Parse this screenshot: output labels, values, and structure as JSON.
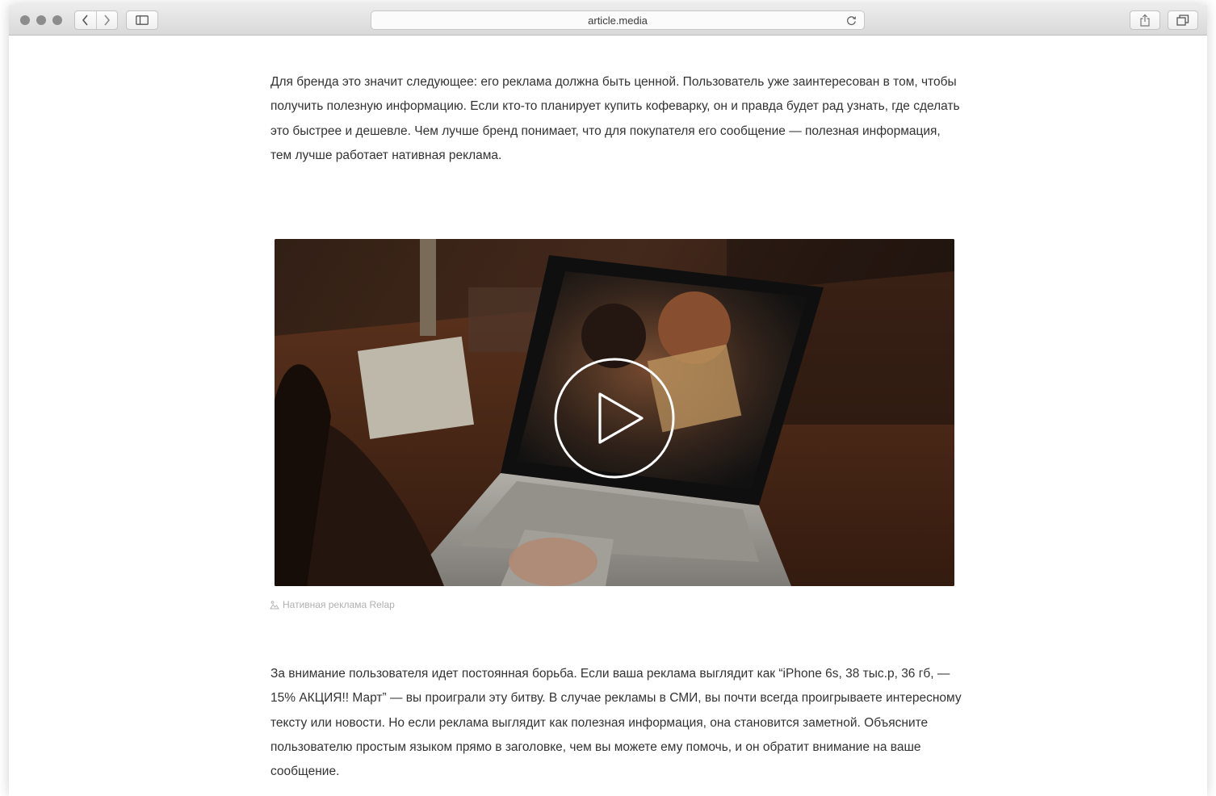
{
  "browser": {
    "url": "article.media",
    "icons": {
      "back": "chevron-left-icon",
      "forward": "chevron-right-icon",
      "sidebar": "sidebar-icon",
      "reload": "reload-icon",
      "share": "share-icon",
      "tabs": "tabs-icon"
    }
  },
  "article": {
    "paragraph1": "Для бренда это значит следующее: его реклама должна быть ценной. Пользователь уже заинтересован в том, чтобы получить полезную информацию. Если кто-то планирует купить кофеварку, он и правда будет рад узнать, где сделать это быстрее и дешевле. Чем лучше бренд понимает, что для покупателя его сообщение — полезная информация, тем лучше работает нативная реклама.",
    "video_caption": "Нативная реклама Relap",
    "paragraph2": "За внимание пользователя идет постоянная борьба. Если ваша реклама выглядит как “iPhone 6s, 38 тыс.р, 36 гб, — 15% АКЦИЯ!! Март” — вы проиграли эту битву. В случае рекламы в СМИ, вы почти всегда проигрываете интересному тексту или новости. Но если реклама выглядит как полезная информация, она становится заметной. Объясните пользователю простым языком прямо в заголовке, чем вы можете ему помочь, и он обратит внимание на ваше сообщение."
  }
}
